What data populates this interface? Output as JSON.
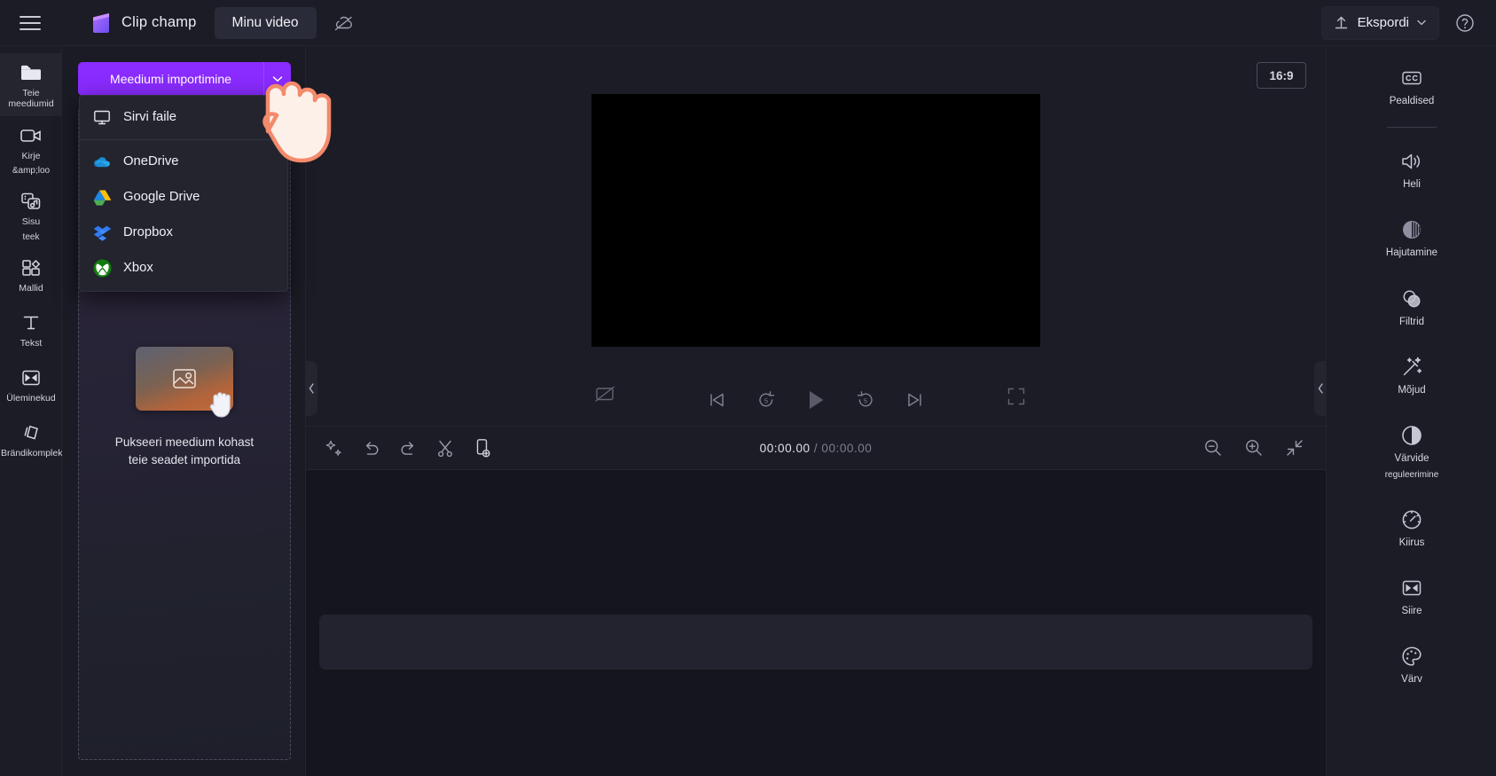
{
  "topbar": {
    "menu_icon": "hamburger-icon",
    "brand": "Clip champ",
    "project_tab": "Minu video",
    "cloud_icon": "cloud-off-icon",
    "export_label": "Ekspordi",
    "export_icon": "upload-icon",
    "help_icon": "help-circle-icon"
  },
  "left_rail": {
    "items": [
      {
        "label": "Teie meediumid",
        "icon": "folder-icon",
        "active": true
      },
      {
        "label": "Kirje",
        "sublabel": "&amp;loo",
        "icon": "video-camera-icon",
        "active": false
      },
      {
        "label": "Sisu",
        "sublabel": "teek",
        "icon": "content-library-icon",
        "active": false
      },
      {
        "label": "Mallid",
        "icon": "templates-icon",
        "active": false
      },
      {
        "label": "Tekst",
        "icon": "text-icon",
        "active": false
      },
      {
        "label": "Üleminekud",
        "icon": "transitions-icon",
        "active": false
      },
      {
        "label": "Brändikomplekt",
        "icon": "brand-kit-icon",
        "active": false
      }
    ]
  },
  "media_panel": {
    "import_label": "Meediumi importimine",
    "import_caret_icon": "chevron-down-icon",
    "accent_color": "#8a2bff",
    "dropzone": {
      "text_line1": "Pukseeri meedium kohast",
      "text_line2": "teie seadet importida",
      "card_icon": "image-search-icon",
      "hand_icon": "drag-hand-icon"
    }
  },
  "import_menu": {
    "items": [
      {
        "label": "Sirvi faile",
        "icon": "monitor-icon"
      },
      {
        "label": "OneDrive",
        "icon": "onedrive-icon"
      },
      {
        "label": "Google Drive",
        "icon": "google-drive-icon"
      },
      {
        "label": "Dropbox",
        "icon": "dropbox-icon"
      },
      {
        "label": "Xbox",
        "icon": "xbox-icon"
      }
    ]
  },
  "stage": {
    "aspect_ratio": "16:9",
    "collapse_left_icon": "chevron-left-icon",
    "collapse_right_icon": "chevron-left-icon",
    "player": {
      "captions_icon": "captions-off-icon",
      "skip_start_icon": "skip-to-start-icon",
      "back5_icon": "rewind-5-icon",
      "play_icon": "play-icon",
      "forward5_icon": "forward-5-icon",
      "skip_end_icon": "skip-to-end-icon",
      "fullscreen_icon": "fullscreen-icon"
    }
  },
  "timeline": {
    "tools": [
      {
        "icon": "magic-wand-icon",
        "name": "auto-compose-button"
      },
      {
        "icon": "undo-icon",
        "name": "undo-button"
      },
      {
        "icon": "redo-icon",
        "name": "redo-button"
      },
      {
        "icon": "scissors-icon",
        "name": "split-button"
      },
      {
        "icon": "duplicate-icon",
        "name": "duplicate-button"
      }
    ],
    "current_time": "00:00.00",
    "separator": "/",
    "total_time": "00:00.00",
    "zoom_out_icon": "zoom-out-icon",
    "zoom_in_icon": "zoom-in-icon",
    "fit_icon": "fit-to-screen-icon"
  },
  "right_rail": {
    "items": [
      {
        "label": "Pealdised",
        "icon": "closed-captions-icon",
        "separator_after": true
      },
      {
        "label": "Heli",
        "icon": "speaker-icon"
      },
      {
        "label": "Hajutamine",
        "icon": "fade-icon"
      },
      {
        "label": "Filtrid",
        "icon": "filters-icon"
      },
      {
        "label": "Mõjud",
        "icon": "effects-wand-icon"
      },
      {
        "label": "Värvide",
        "sublabel": "reguleerimine",
        "icon": "color-balance-icon"
      },
      {
        "label": "Kiirus",
        "icon": "speedometer-icon"
      },
      {
        "label": "Siire",
        "icon": "transition-icon"
      },
      {
        "label": "Värv",
        "icon": "palette-icon"
      }
    ]
  }
}
